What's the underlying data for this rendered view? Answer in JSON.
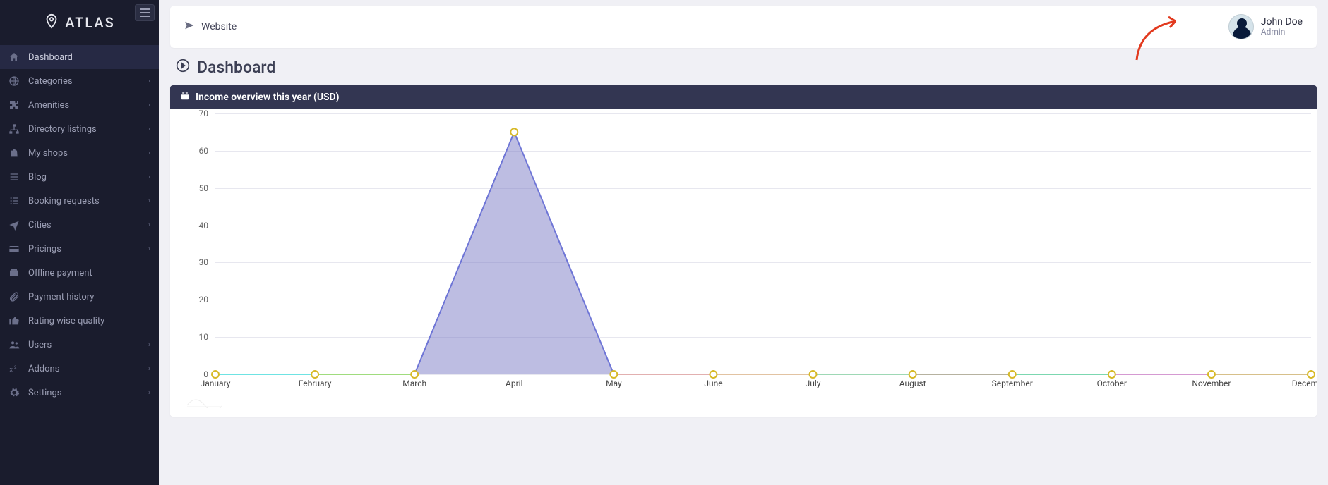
{
  "brand": {
    "name": "ATLAS"
  },
  "topbar": {
    "website_label": "Website"
  },
  "user": {
    "name": "John Doe",
    "role": "Admin"
  },
  "page": {
    "title": "Dashboard"
  },
  "sidebar": {
    "items": [
      {
        "label": "Dashboard",
        "icon": "home",
        "expandable": false,
        "active": true
      },
      {
        "label": "Categories",
        "icon": "globe",
        "expandable": true,
        "active": false
      },
      {
        "label": "Amenities",
        "icon": "puzzle",
        "expandable": true,
        "active": false
      },
      {
        "label": "Directory listings",
        "icon": "sitemap",
        "expandable": true,
        "active": false
      },
      {
        "label": "My shops",
        "icon": "bag",
        "expandable": true,
        "active": false
      },
      {
        "label": "Blog",
        "icon": "list",
        "expandable": true,
        "active": false
      },
      {
        "label": "Booking requests",
        "icon": "tasks",
        "expandable": true,
        "active": false
      },
      {
        "label": "Cities",
        "icon": "plane",
        "expandable": true,
        "active": false
      },
      {
        "label": "Pricings",
        "icon": "card",
        "expandable": true,
        "active": false
      },
      {
        "label": "Offline payment",
        "icon": "receipt",
        "expandable": false,
        "active": false
      },
      {
        "label": "Payment history",
        "icon": "attach",
        "expandable": false,
        "active": false
      },
      {
        "label": "Rating wise quality",
        "icon": "thumb",
        "expandable": false,
        "active": false
      },
      {
        "label": "Users",
        "icon": "users",
        "expandable": true,
        "active": false
      },
      {
        "label": "Addons",
        "icon": "super",
        "expandable": true,
        "active": false
      },
      {
        "label": "Settings",
        "icon": "gear",
        "expandable": true,
        "active": false
      }
    ]
  },
  "card": {
    "title": "Income overview this year (USD)"
  },
  "chart_data": {
    "type": "area",
    "title": "Income overview this year (USD)",
    "xlabel": "",
    "ylabel": "",
    "ylim": [
      0,
      70
    ],
    "yticks": [
      0,
      10,
      20,
      30,
      40,
      50,
      60,
      70
    ],
    "categories": [
      "January",
      "February",
      "March",
      "April",
      "May",
      "June",
      "July",
      "August",
      "September",
      "October",
      "November",
      "December"
    ],
    "values": [
      0,
      0,
      0,
      65,
      0,
      0,
      0,
      0,
      0,
      0,
      0,
      0
    ],
    "segment_colors": [
      "#6fe3e3",
      "#a0dc7e",
      "#b99ae0",
      "#b99ae0",
      "#e2b0b0",
      "#e2c3a2",
      "#9ed8b5",
      "#b6b2a0",
      "#7cd7b0",
      "#d59ad2",
      "#d7c08a",
      "#b0b0b0"
    ],
    "point_color_stroke": "#d7b927",
    "point_color_fill": "#ffffff",
    "area_fill": "#7c7cc5",
    "line_color_peak": "#6e75d6"
  }
}
